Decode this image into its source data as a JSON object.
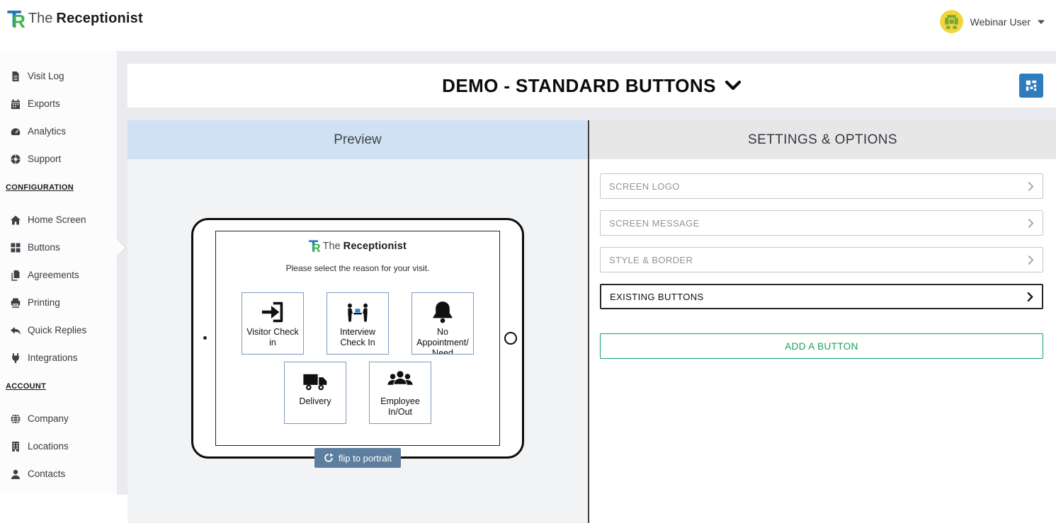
{
  "brand": {
    "the": "The",
    "name": "Receptionist"
  },
  "header": {
    "user_name": "Webinar User"
  },
  "sidebar": {
    "items_top": [
      {
        "label": "Visit Log",
        "icon": "visit-log-icon"
      },
      {
        "label": "Exports",
        "icon": "exports-icon"
      },
      {
        "label": "Analytics",
        "icon": "analytics-icon"
      },
      {
        "label": "Support",
        "icon": "support-icon"
      }
    ],
    "configuration_heading": "CONFIGURATION",
    "items_configuration": [
      {
        "label": "Home Screen",
        "icon": "home-icon"
      },
      {
        "label": "Buttons",
        "icon": "buttons-grid-icon",
        "active": true
      },
      {
        "label": "Agreements",
        "icon": "agreements-icon"
      },
      {
        "label": "Printing",
        "icon": "printer-icon"
      },
      {
        "label": "Quick Replies",
        "icon": "reply-icon"
      },
      {
        "label": "Integrations",
        "icon": "plug-icon"
      }
    ],
    "account_heading": "ACCOUNT",
    "items_account": [
      {
        "label": "Company",
        "icon": "globe-icon"
      },
      {
        "label": "Locations",
        "icon": "building-icon"
      },
      {
        "label": "Contacts",
        "icon": "person-icon"
      }
    ]
  },
  "title_bar": {
    "title": "DEMO - STANDARD BUTTONS"
  },
  "preview": {
    "header": "Preview",
    "tablet": {
      "message": "Please select the reason for your visit.",
      "buttons": [
        {
          "label": "Visitor Check in",
          "icon": "sign-in-icon"
        },
        {
          "label": "Interview Check In",
          "icon": "interview-icon"
        },
        {
          "label": "No Appointment/Need Assistance",
          "icon": "bell-icon"
        },
        {
          "label": "Delivery",
          "icon": "truck-icon"
        },
        {
          "label": "Employee In/Out",
          "icon": "people-icon"
        }
      ]
    },
    "flip_button_label": "flip to portrait"
  },
  "settings": {
    "header": "SETTINGS & OPTIONS",
    "rows": [
      {
        "label": "SCREEN LOGO"
      },
      {
        "label": "SCREEN MESSAGE"
      },
      {
        "label": "STYLE & BORDER"
      },
      {
        "label": "EXISTING BUTTONS",
        "active": true
      }
    ],
    "add_button_label": "ADD A BUTTON"
  },
  "colors": {
    "brand_blue": "#1c75bc",
    "brand_green": "#3bb54a",
    "accent_green": "#18a261",
    "qr_button_blue": "#2d7cbe",
    "flip_button_slate": "#5d7e9e",
    "preview_header_bg": "#cfe1f2"
  }
}
